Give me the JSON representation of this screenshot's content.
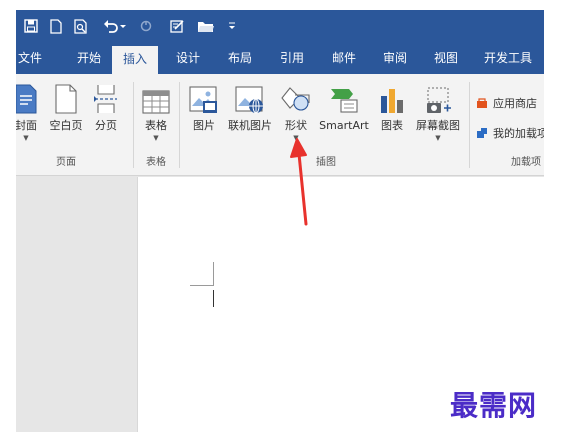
{
  "quick_access": {
    "icons": [
      "save-icon",
      "new-document-icon",
      "print-preview-icon",
      "undo-icon",
      "redo-icon",
      "edit-icon",
      "open-folder-icon",
      "customize-icon"
    ]
  },
  "tabs": [
    {
      "label": "文件"
    },
    {
      "label": "开始"
    },
    {
      "label": "插入",
      "active": true
    },
    {
      "label": "设计"
    },
    {
      "label": "布局"
    },
    {
      "label": "引用"
    },
    {
      "label": "邮件"
    },
    {
      "label": "审阅"
    },
    {
      "label": "视图"
    },
    {
      "label": "开发工具"
    }
  ],
  "ribbon": {
    "pages": {
      "group_label": "页面",
      "buttons": [
        {
          "label": "封面",
          "icon": "cover-page-icon"
        },
        {
          "label": "空白页",
          "icon": "blank-page-icon"
        },
        {
          "label": "分页",
          "icon": "page-break-icon"
        }
      ]
    },
    "tables": {
      "group_label": "表格",
      "buttons": [
        {
          "label": "表格",
          "icon": "table-icon"
        }
      ]
    },
    "illustrations": {
      "group_label": "插图",
      "buttons": [
        {
          "label": "图片",
          "icon": "picture-icon"
        },
        {
          "label": "联机图片",
          "icon": "online-picture-icon"
        },
        {
          "label": "形状",
          "icon": "shapes-icon"
        },
        {
          "label": "SmartArt",
          "icon": "smartart-icon"
        },
        {
          "label": "图表",
          "icon": "chart-icon"
        },
        {
          "label": "屏幕截图",
          "icon": "screenshot-icon"
        }
      ]
    },
    "addins": {
      "group_label": "加载项",
      "items": [
        {
          "label": "应用商店",
          "icon": "store-icon"
        },
        {
          "label": "我的加载项",
          "icon": "my-addins-icon"
        }
      ]
    }
  },
  "colors": {
    "accent": "#2b579a",
    "arrow": "#e8322d",
    "watermark": "#4b2cc7"
  },
  "watermark": "最需网"
}
